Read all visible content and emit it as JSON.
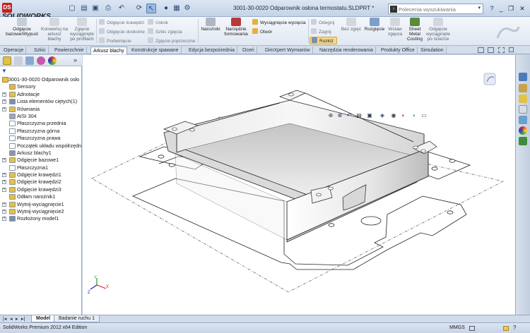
{
  "app": {
    "logo_text": "SOLIDWORKS",
    "logo_prefix": "DS",
    "document_title": "3001-30-0020 Odparownik osłona termostatu.SLDPRT *"
  },
  "search": {
    "placeholder": "Polecenia wyszukiwania"
  },
  "ribbon": {
    "big_buttons": [
      {
        "label": "Odgięcie bazowe/Wypust",
        "enabled": true
      },
      {
        "label": "Konwertuj na arkusz blachy",
        "enabled": false
      },
      {
        "label": "Zgięcie wyciągnięte po profilach",
        "enabled": false
      },
      {
        "label": "Narożniki",
        "enabled": true
      },
      {
        "label": "Narzędzie formowania",
        "enabled": true
      },
      {
        "label": "Bez zgięć",
        "enabled": false
      },
      {
        "label": "Rozgięcie",
        "enabled": true
      },
      {
        "label": "Wstaw zgięcia",
        "enabled": false
      },
      {
        "label": "Sheet Metal Costing",
        "enabled": true
      },
      {
        "label": "Odgięcie wyciągnięte po ścieżce",
        "enabled": false
      }
    ],
    "small_buttons": [
      {
        "label": "Odgięcie krawędzi",
        "enabled": false
      },
      {
        "label": "Odgięcie dookolne",
        "enabled": false
      },
      {
        "label": "Podwinięcie",
        "enabled": false
      },
      {
        "label": "Uskok",
        "enabled": false
      },
      {
        "label": "Szkic zgięcia",
        "enabled": false
      },
      {
        "label": "Zgięcie poprzeczne",
        "enabled": false
      },
      {
        "label": "Wyciągnięcie wycięcia",
        "enabled": true
      },
      {
        "label": "Otwór",
        "enabled": true
      },
      {
        "label": "Odegnij",
        "enabled": false
      },
      {
        "label": "Zagnij",
        "enabled": false
      },
      {
        "label": "Rozłóż",
        "enabled": true,
        "highlighted": true
      }
    ]
  },
  "tabs": [
    {
      "label": "Operacje",
      "active": false
    },
    {
      "label": "Szkic",
      "active": false
    },
    {
      "label": "Powierzchnie",
      "active": false
    },
    {
      "label": "Arkusz blachy",
      "active": true
    },
    {
      "label": "Konstrukcje spawane",
      "active": false
    },
    {
      "label": "Edycja bezpośrednia",
      "active": false
    },
    {
      "label": "Oceń",
      "active": false
    },
    {
      "label": "DimXpert Wymiarów",
      "active": false
    },
    {
      "label": "Narzędzia renderowania",
      "active": false
    },
    {
      "label": "Produkty Office",
      "active": false
    },
    {
      "label": "Simulation",
      "active": false
    }
  ],
  "tree": {
    "root": "3001-30-0020 Odparownik osło",
    "items": [
      {
        "label": "Sensory",
        "expandable": false,
        "icon": "sensor-icon",
        "color": "#e7b443"
      },
      {
        "label": "Adnotacje",
        "expandable": true,
        "icon": "annotation-icon",
        "color": "#e2c148"
      },
      {
        "label": "Lista elementów ciętych(1)",
        "expandable": true,
        "icon": "cut-list-icon",
        "color": "#7d8fa6"
      },
      {
        "label": "Równania",
        "expandable": true,
        "icon": "equation-icon",
        "color": "#e2c148"
      },
      {
        "label": "AISI 304",
        "expandable": false,
        "icon": "material-icon",
        "color": "#a0a6b0"
      },
      {
        "label": "Płaszczyzna przednia",
        "expandable": false,
        "icon": "plane-icon",
        "color": "#ffffff"
      },
      {
        "label": "Płaszczyzna górna",
        "expandable": false,
        "icon": "plane-icon",
        "color": "#ffffff"
      },
      {
        "label": "Płaszczyzna prawa",
        "expandable": false,
        "icon": "plane-icon",
        "color": "#ffffff"
      },
      {
        "label": "Początek układu współrzędn",
        "expandable": false,
        "icon": "origin-icon",
        "color": "#ffffff"
      },
      {
        "label": "Arkusz blachy1",
        "expandable": false,
        "icon": "sheet-metal-icon",
        "color": "#8a96a6"
      },
      {
        "label": "Odgięcie bazowe1",
        "expandable": true,
        "icon": "base-flange-icon",
        "color": "#e2c148"
      },
      {
        "label": "Płaszczyzna1",
        "expandable": false,
        "icon": "plane-icon",
        "color": "#ffffff"
      },
      {
        "label": "Odgięcie krawędzi1",
        "expandable": true,
        "icon": "edge-flange-icon",
        "color": "#e2c148"
      },
      {
        "label": "Odgięcie krawędzi2",
        "expandable": true,
        "icon": "edge-flange-icon",
        "color": "#e2c148"
      },
      {
        "label": "Odgięcie krawędzi3",
        "expandable": true,
        "icon": "edge-flange-icon",
        "color": "#e2c148"
      },
      {
        "label": "Odłam narożnik1",
        "expandable": false,
        "icon": "break-corner-icon",
        "color": "#e2c148"
      },
      {
        "label": "Wytnij-wyciągnięcie1",
        "expandable": true,
        "icon": "cut-extrude-icon",
        "color": "#e2c148"
      },
      {
        "label": "Wytnij-wyciągnięcie2",
        "expandable": true,
        "icon": "cut-extrude-icon",
        "color": "#e2c148"
      },
      {
        "label": "Rozłożony model1",
        "expandable": true,
        "icon": "flat-pattern-icon",
        "color": "#7d8fa6"
      }
    ]
  },
  "bottom_tabs": [
    {
      "label": "Model",
      "active": true
    },
    {
      "label": "Badanie ruchu 1",
      "active": false
    }
  ],
  "status": {
    "edition": "SolidWorks Premium 2012 x64 Edition",
    "units": "MMGS"
  },
  "colors": {
    "accent": "#c41f1f",
    "ribbon": "#e1e8f2",
    "viewport": "#ffffff"
  }
}
